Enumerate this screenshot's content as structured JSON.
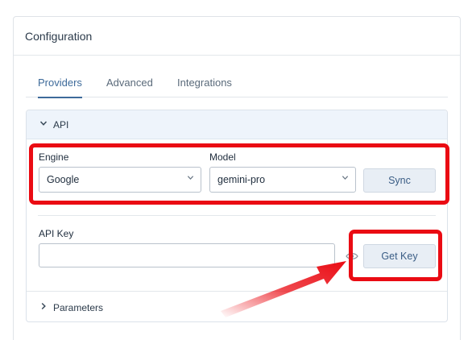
{
  "header": {
    "title": "Configuration"
  },
  "tabs": [
    {
      "label": "Providers",
      "active": true
    },
    {
      "label": "Advanced",
      "active": false
    },
    {
      "label": "Integrations",
      "active": false
    }
  ],
  "api_section": {
    "title": "API",
    "expanded": true,
    "engine": {
      "label": "Engine",
      "value": "Google"
    },
    "model": {
      "label": "Model",
      "value": "gemini-pro"
    },
    "sync_label": "Sync",
    "api_key": {
      "label": "API Key",
      "value": ""
    },
    "get_key_label": "Get Key"
  },
  "parameters_section": {
    "title": "Parameters",
    "expanded": false
  },
  "annotations": {
    "highlight_color": "#ea0b13"
  },
  "icons": {
    "api_chevron": "chevron-down-icon",
    "parameters_chevron": "chevron-right-icon",
    "select_caret": "chevron-down-icon",
    "visibility": "eye-icon"
  }
}
